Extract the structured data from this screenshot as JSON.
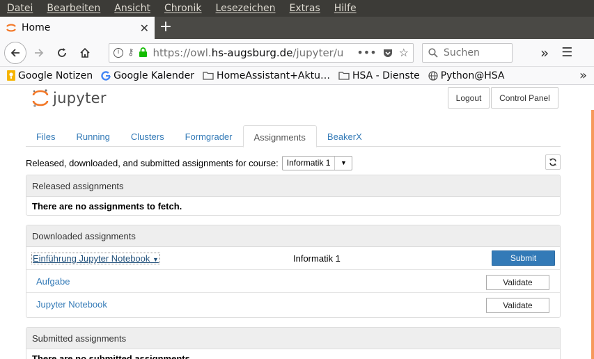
{
  "menubar": {
    "items": [
      "Datei",
      "Bearbeiten",
      "Ansicht",
      "Chronik",
      "Lesezeichen",
      "Extras",
      "Hilfe"
    ]
  },
  "browser": {
    "tab_title": "Home",
    "url_prefix": "https://owl.",
    "url_domain": "hs-augsburg.de",
    "url_path": "/jupyter/u",
    "search_placeholder": "Suchen"
  },
  "bookmarks": [
    {
      "label": "Google Notizen",
      "icon": "google-keep-icon"
    },
    {
      "label": "Google Kalender",
      "icon": "google-icon"
    },
    {
      "label": "HomeAssistant+Aktu…",
      "icon": "folder-icon"
    },
    {
      "label": "HSA - Dienste",
      "icon": "folder-icon"
    },
    {
      "label": "Python@HSA",
      "icon": "globe-icon"
    }
  ],
  "jupyter": {
    "logo_text": "jupyter",
    "logout_label": "Logout",
    "control_panel_label": "Control Panel",
    "tabs": [
      "Files",
      "Running",
      "Clusters",
      "Formgrader",
      "Assignments",
      "BeakerX"
    ],
    "active_tab": "Assignments",
    "course_prompt": "Released, downloaded, and submitted assignments for course:",
    "course_selected": "Informatik 1",
    "released": {
      "title": "Released assignments",
      "message": "There are no assignments to fetch."
    },
    "downloaded": {
      "title": "Downloaded assignments",
      "assignment": {
        "name": "Einführung Jupyter Notebook",
        "course": "Informatik 1",
        "submit_label": "Submit"
      },
      "notebooks": [
        {
          "name": "Aufgabe",
          "validate_label": "Validate"
        },
        {
          "name": "Jupyter Notebook",
          "validate_label": "Validate"
        }
      ]
    },
    "submitted": {
      "title": "Submitted assignments",
      "message": "There are no submitted assignments."
    }
  },
  "colors": {
    "accent": "#f37726",
    "link": "#337ab7",
    "primary": "#337ab7"
  }
}
